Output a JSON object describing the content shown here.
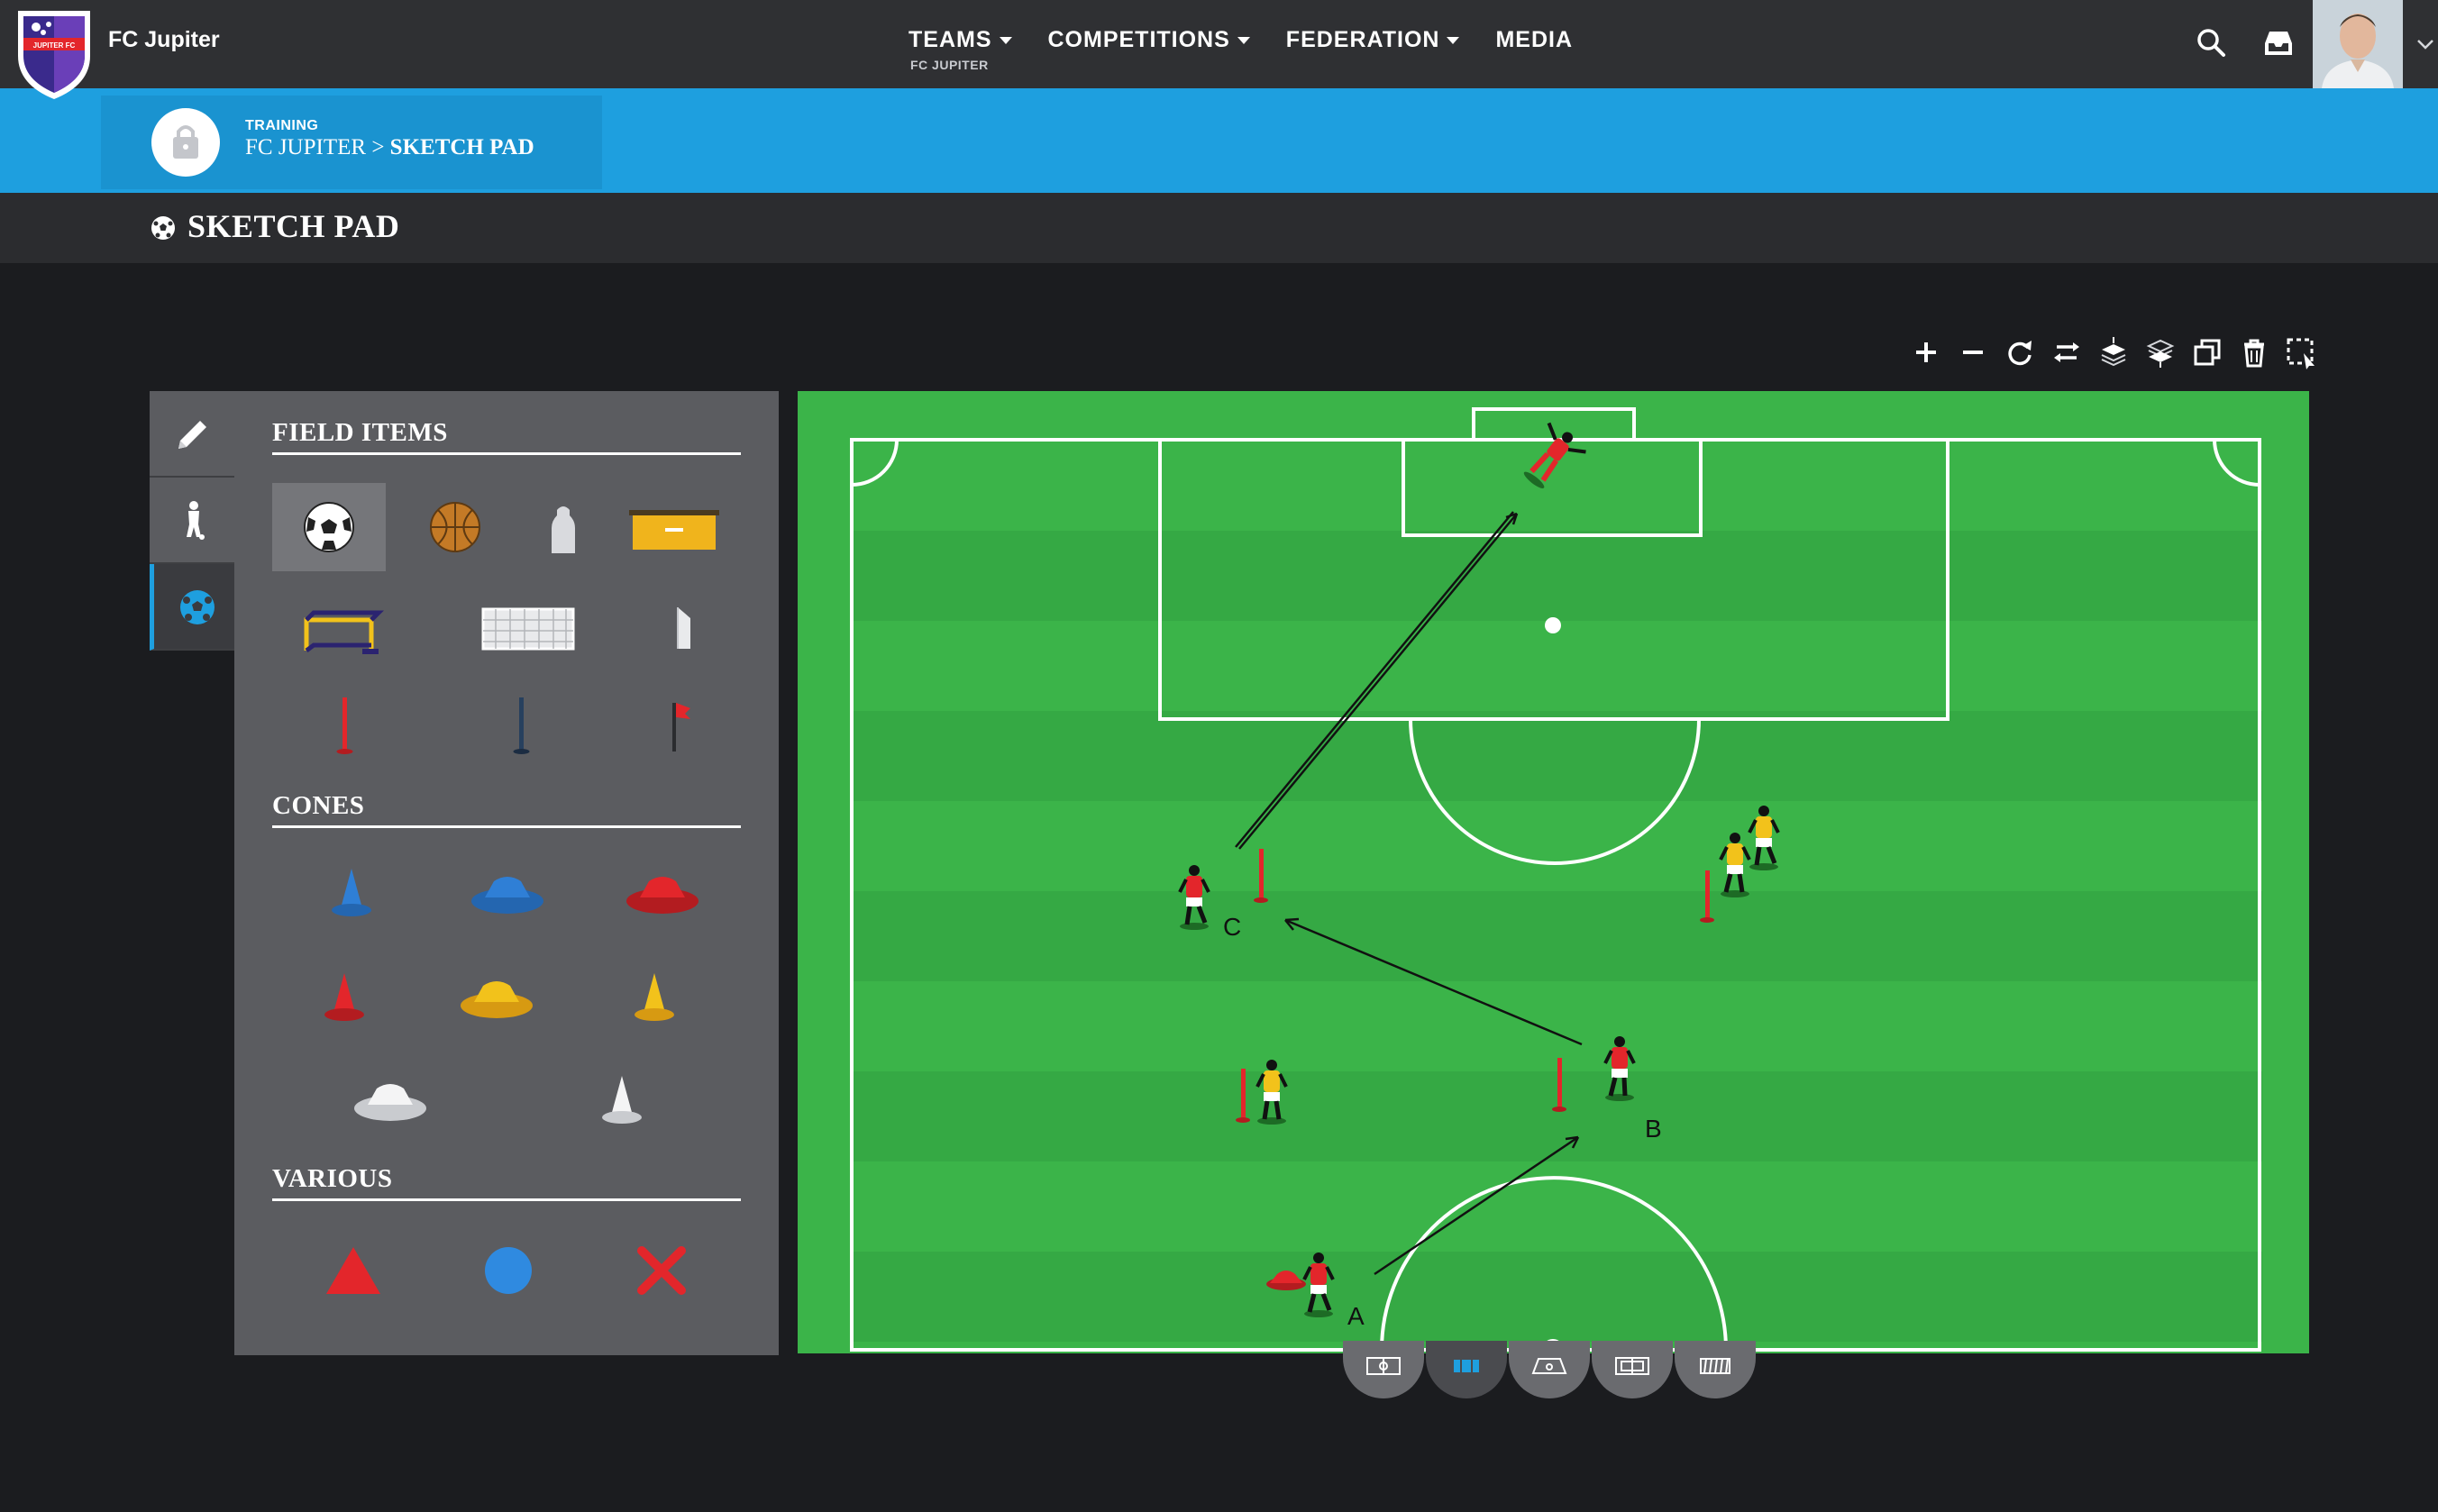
{
  "header": {
    "brand": "FC Jupiter",
    "logo_text": "JUPITER FC",
    "nav": [
      {
        "label": "TEAMS",
        "sub": "FC JUPITER",
        "has_caret": true
      },
      {
        "label": "COMPETITIONS",
        "sub": "",
        "has_caret": true
      },
      {
        "label": "FEDERATION",
        "sub": "",
        "has_caret": true
      },
      {
        "label": "MEDIA",
        "sub": "",
        "has_caret": false
      }
    ],
    "icons": [
      "search-icon",
      "inbox-icon",
      "avatar",
      "chevron-down-icon"
    ]
  },
  "breadcrumb": {
    "section": "TRAINING",
    "parent": "FC JUPITER",
    "separator": ">",
    "current": "SKETCH PAD"
  },
  "page": {
    "title": "SKETCH PAD"
  },
  "toolbar": [
    "zoom-in-icon",
    "zoom-out-icon",
    "rotate-icon",
    "flip-icon",
    "bring-forward-icon",
    "send-backward-icon",
    "duplicate-icon",
    "delete-icon",
    "select-area-icon"
  ],
  "tabs": [
    "pencil-icon",
    "player-icon",
    "ball-icon"
  ],
  "palette": {
    "field_items_title": "FIELD ITEMS",
    "cones_title": "CONES",
    "various_title": "VARIOUS",
    "field_items": [
      "football",
      "basketball",
      "dummy",
      "box",
      "mini-goal",
      "goal",
      "flag-board",
      "red-pole",
      "blue-pole",
      "corner-flag"
    ],
    "cones": [
      "blue-tall-cone",
      "blue-flat-cone",
      "red-flat-cone",
      "red-tall-cone",
      "yellow-flat-cone",
      "yellow-tall-cone",
      "white-flat-cone",
      "white-tall-cone"
    ],
    "various": [
      "red-triangle",
      "blue-circle",
      "red-cross"
    ]
  },
  "field": {
    "labels": {
      "a": "A",
      "b": "B",
      "c": "C"
    }
  },
  "views": [
    "full-pitch-view",
    "drills-view",
    "half-pitch-view",
    "penalty-view",
    "blank-view"
  ],
  "colors": {
    "accent": "#1e9fdf",
    "pitch": "#3bb449",
    "pitch_stripe": "#35a944",
    "team_red": "#e3262b",
    "team_yellow": "#f2c21b"
  }
}
